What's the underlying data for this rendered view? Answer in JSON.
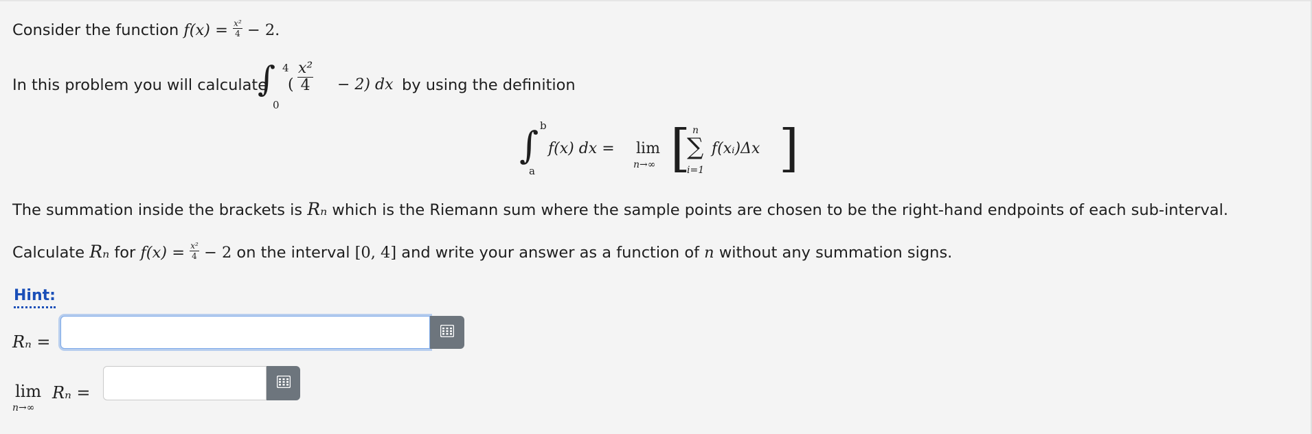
{
  "problem": {
    "line1_text": "Consider the function",
    "line1_fx": "f(x) =",
    "line1_num": "x²",
    "line1_den": "4",
    "line1_tail": "− 2.",
    "line2_text": "In this problem you will calculate",
    "line2_int_upper": "4",
    "line2_int_lower": "0",
    "line2_num": "x²",
    "line2_den": "4",
    "line2_tail": "− 2) dx",
    "line2_after": "by using the definition",
    "def_upper": "b",
    "def_lower": "a",
    "def_integrand": "f(x) dx =",
    "def_lim": "lim",
    "def_lim_sub": "n→∞",
    "def_sum_upper": "n",
    "def_sum_lower": "i=1",
    "def_sum_body": "f(xᵢ)Δx",
    "line3_pre": "The summation inside the brackets is",
    "line3_Rn": "Rₙ",
    "line3_post": "which is the Riemann sum where the sample points are chosen to be the right-hand endpoints of each sub-interval.",
    "line4_pre": "Calculate",
    "line4_Rn": "Rₙ",
    "line4_for": "for",
    "line4_fx": "f(x) =",
    "line4_num": "x²",
    "line4_den": "4",
    "line4_minus": "− 2",
    "line4_mid": "on the interval",
    "line4_interval": "[0, 4]",
    "line4_end1": "and write your answer as a function of",
    "line4_n": "n",
    "line4_end2": "without any summation signs."
  },
  "hint": {
    "label": "Hint:"
  },
  "answers": {
    "rn_label": "Rₙ =",
    "rn_value": "",
    "limit_lim": "lim",
    "limit_sub": "n→∞",
    "limit_expr": "Rₙ =",
    "limit_value": ""
  },
  "icons": {
    "grid": "grid-icon"
  },
  "colors": {
    "hint": "#1a4fb8",
    "focus": "#7aa7e8",
    "button": "#6d757d"
  }
}
